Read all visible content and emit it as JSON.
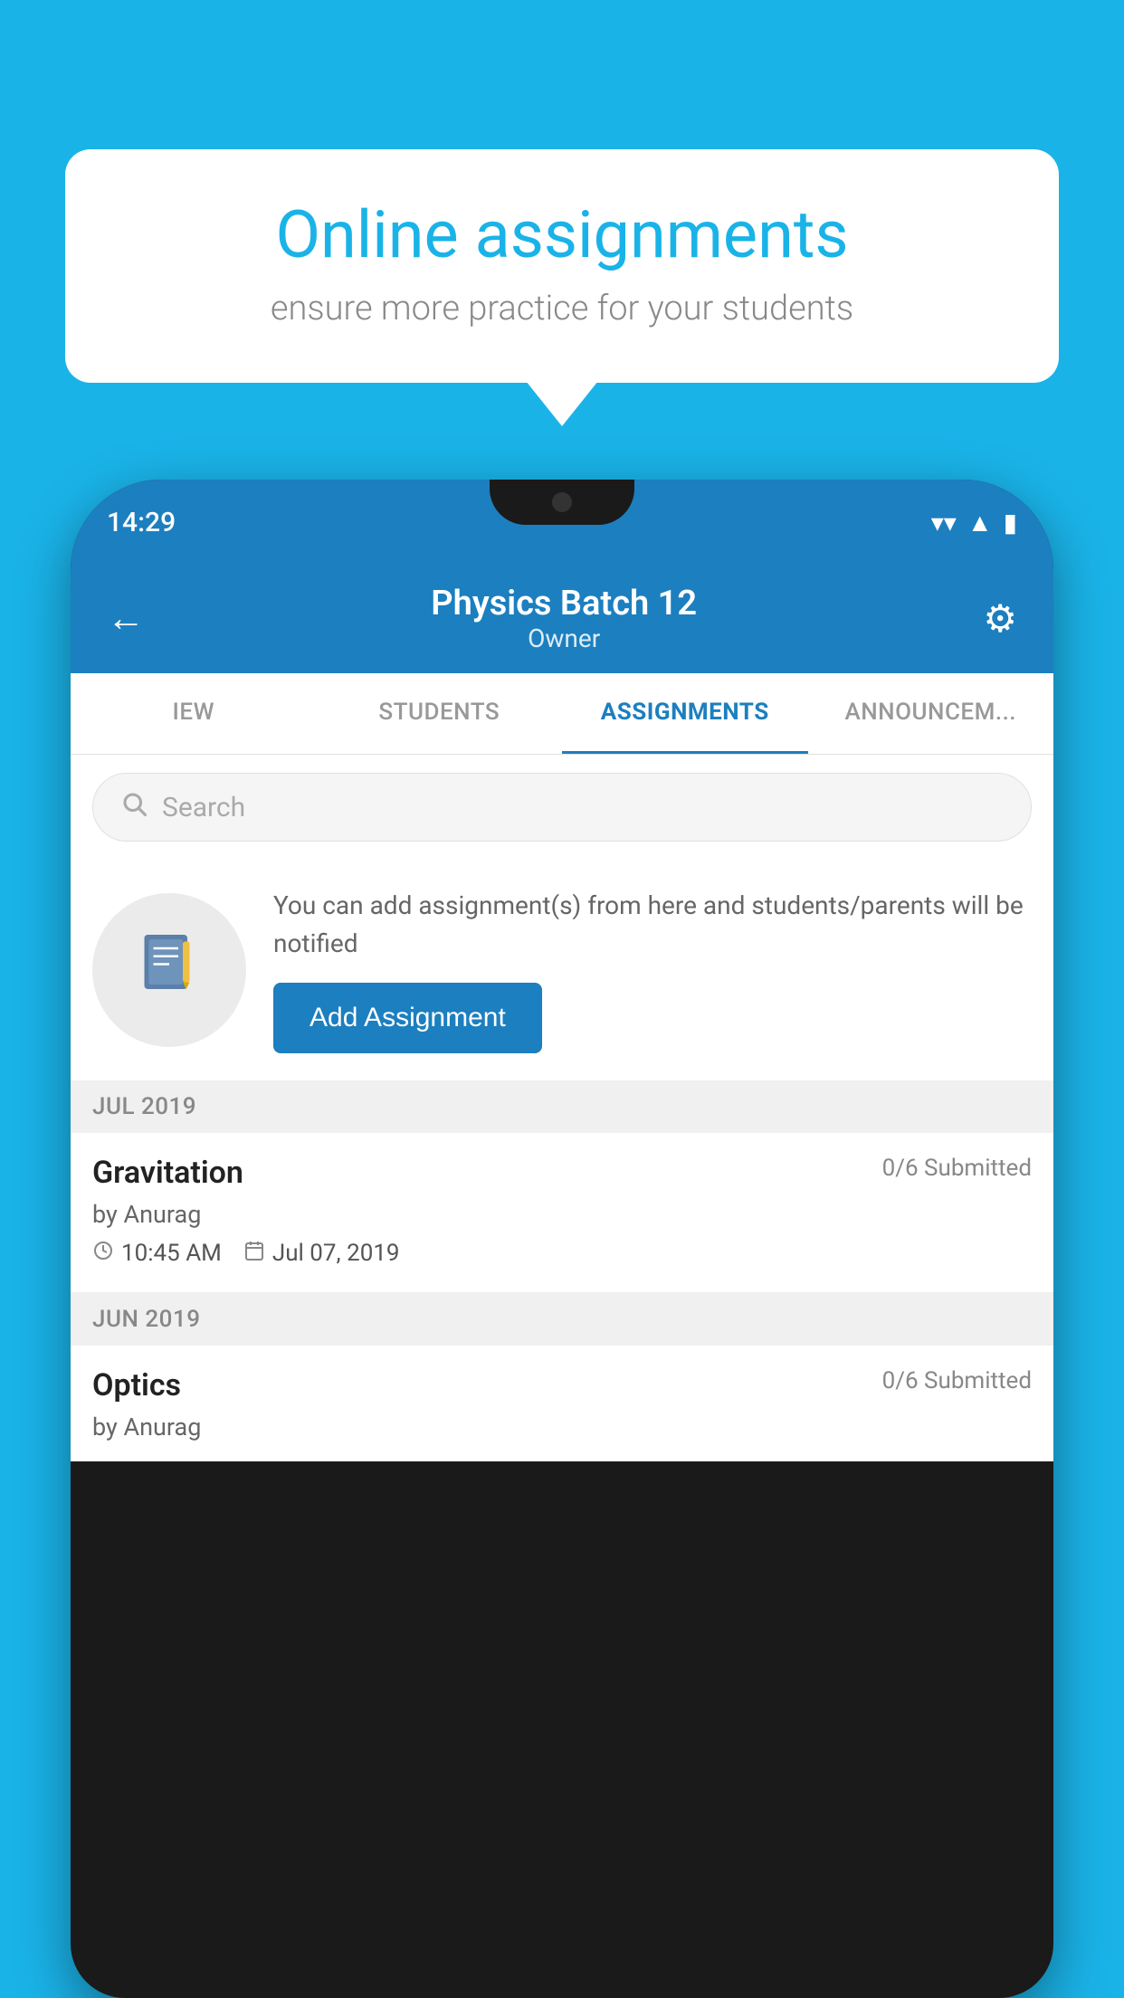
{
  "background_color": "#1ab3e8",
  "speech_bubble": {
    "title": "Online assignments",
    "subtitle": "ensure more practice for your students"
  },
  "phone": {
    "status_bar": {
      "time": "14:29",
      "icons": [
        "wifi",
        "signal",
        "battery"
      ]
    },
    "header": {
      "title": "Physics Batch 12",
      "subtitle": "Owner",
      "back_label": "←",
      "settings_label": "⚙"
    },
    "tabs": [
      {
        "label": "IEW",
        "active": false
      },
      {
        "label": "STUDENTS",
        "active": false
      },
      {
        "label": "ASSIGNMENTS",
        "active": true
      },
      {
        "label": "ANNOUNCEM...",
        "active": false
      }
    ],
    "search": {
      "placeholder": "Search"
    },
    "info_section": {
      "text": "You can add assignment(s) from here and students/parents will be notified",
      "button_label": "Add Assignment"
    },
    "sections": [
      {
        "month": "JUL 2019",
        "assignments": [
          {
            "name": "Gravitation",
            "submitted": "0/6 Submitted",
            "by": "by Anurag",
            "time": "10:45 AM",
            "date": "Jul 07, 2019"
          }
        ]
      },
      {
        "month": "JUN 2019",
        "assignments": [
          {
            "name": "Optics",
            "submitted": "0/6 Submitted",
            "by": "by Anurag",
            "time": "",
            "date": ""
          }
        ]
      }
    ]
  }
}
